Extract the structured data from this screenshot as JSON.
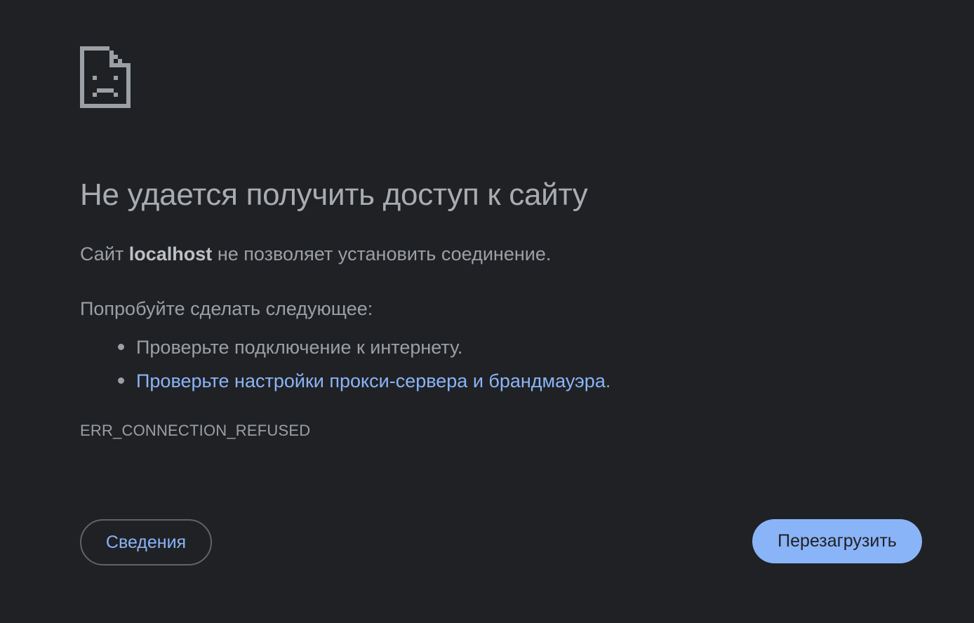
{
  "icon": "sad-page-icon",
  "headline": "Не удается получить доступ к сайту",
  "summary": {
    "prefix": "Сайт ",
    "host": "localhost",
    "suffix": " не позволяет установить соединение."
  },
  "suggestions": {
    "heading": "Попробуйте сделать следующее:",
    "items": [
      {
        "text": "Проверьте подключение к интернету."
      },
      {
        "link_text": "Проверьте настройки прокси-сервера и брандмауэра",
        "after": "."
      }
    ]
  },
  "error_code": "ERR_CONNECTION_REFUSED",
  "buttons": {
    "details": "Сведения",
    "reload": "Перезагрузить"
  },
  "colors": {
    "background": "#202124",
    "text": "#9aa0a6",
    "link": "#8ab4f8",
    "primary_button": "#8ab4f8"
  }
}
